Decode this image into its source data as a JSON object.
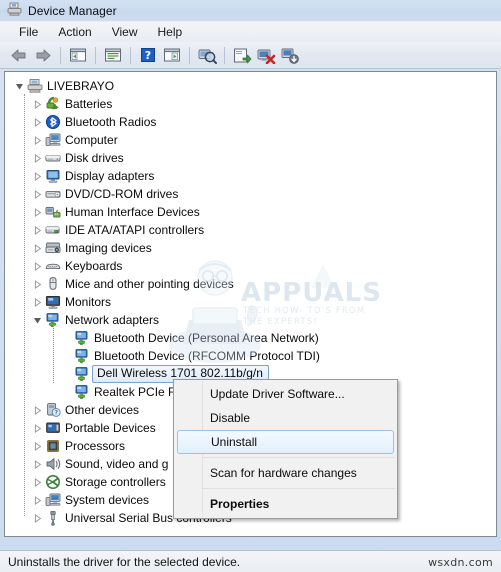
{
  "window": {
    "title": "Device Manager",
    "title_icon": "device-manager-icon"
  },
  "menubar": {
    "items": [
      {
        "label": "File",
        "name": "menu-file"
      },
      {
        "label": "Action",
        "name": "menu-action"
      },
      {
        "label": "View",
        "name": "menu-view"
      },
      {
        "label": "Help",
        "name": "menu-help"
      }
    ]
  },
  "toolbar": {
    "buttons": [
      {
        "name": "back-arrow-icon",
        "title": "Back"
      },
      {
        "name": "forward-arrow-icon",
        "title": "Forward"
      },
      {
        "name": "separator-1",
        "title": ""
      },
      {
        "name": "show-hide-console-tree-icon",
        "title": "Show/Hide Console Tree"
      },
      {
        "name": "separator-2",
        "title": ""
      },
      {
        "name": "properties-icon",
        "title": "Properties"
      },
      {
        "name": "separator-3",
        "title": ""
      },
      {
        "name": "help-icon",
        "title": "Help"
      },
      {
        "name": "separator-4",
        "title": ""
      },
      {
        "name": "show-hide-action-pane-icon",
        "title": "Show/Hide Action Pane"
      },
      {
        "name": "separator-5",
        "title": ""
      },
      {
        "name": "scan-for-hardware-changes-icon",
        "title": "Scan for hardware changes"
      },
      {
        "name": "separator-6",
        "title": ""
      },
      {
        "name": "update-driver-software-icon",
        "title": "Update Driver Software"
      },
      {
        "name": "uninstall-device-icon",
        "title": "Uninstall"
      },
      {
        "name": "add-legacy-hardware-icon",
        "title": "Add legacy hardware"
      }
    ]
  },
  "tree": {
    "root": {
      "label": "LIVEBRAYO",
      "icon": "computer-node-icon",
      "expanded": true
    },
    "nodes": [
      {
        "label": "Batteries",
        "icon": "battery-icon",
        "depth": 1,
        "expanded": false,
        "selected": false
      },
      {
        "label": "Bluetooth Radios",
        "icon": "bluetooth-icon",
        "depth": 1,
        "expanded": false,
        "selected": false
      },
      {
        "label": "Computer",
        "icon": "computer-icon",
        "depth": 1,
        "expanded": false,
        "selected": false
      },
      {
        "label": "Disk drives",
        "icon": "disk-drive-icon",
        "depth": 1,
        "expanded": false,
        "selected": false
      },
      {
        "label": "Display adapters",
        "icon": "display-adapter-icon",
        "depth": 1,
        "expanded": false,
        "selected": false
      },
      {
        "label": "DVD/CD-ROM drives",
        "icon": "dvd-drive-icon",
        "depth": 1,
        "expanded": false,
        "selected": false
      },
      {
        "label": "Human Interface Devices",
        "icon": "hid-icon",
        "depth": 1,
        "expanded": false,
        "selected": false
      },
      {
        "label": "IDE ATA/ATAPI controllers",
        "icon": "ide-controller-icon",
        "depth": 1,
        "expanded": false,
        "selected": false
      },
      {
        "label": "Imaging devices",
        "icon": "imaging-device-icon",
        "depth": 1,
        "expanded": false,
        "selected": false
      },
      {
        "label": "Keyboards",
        "icon": "keyboard-icon",
        "depth": 1,
        "expanded": false,
        "selected": false
      },
      {
        "label": "Mice and other pointing devices",
        "icon": "mouse-icon",
        "depth": 1,
        "expanded": false,
        "selected": false
      },
      {
        "label": "Monitors",
        "icon": "monitor-icon",
        "depth": 1,
        "expanded": false,
        "selected": false
      },
      {
        "label": "Network adapters",
        "icon": "network-adapter-icon",
        "depth": 1,
        "expanded": true,
        "selected": false
      },
      {
        "label": "Bluetooth Device (Personal Area Network)",
        "icon": "network-adapter-icon",
        "depth": 2,
        "expanded": null,
        "selected": false
      },
      {
        "label": "Bluetooth Device (RFCOMM Protocol TDI)",
        "icon": "network-adapter-icon",
        "depth": 2,
        "expanded": null,
        "selected": false
      },
      {
        "label": "Dell Wireless 1701 802.11b/g/n",
        "icon": "network-adapter-icon",
        "depth": 2,
        "expanded": null,
        "selected": true
      },
      {
        "label": "Realtek PCIe FE",
        "icon": "network-adapter-icon",
        "depth": 2,
        "expanded": null,
        "selected": false
      },
      {
        "label": "Other devices",
        "icon": "unknown-device-icon",
        "depth": 1,
        "expanded": false,
        "selected": false
      },
      {
        "label": "Portable Devices",
        "icon": "portable-device-icon",
        "depth": 1,
        "expanded": false,
        "selected": false
      },
      {
        "label": "Processors",
        "icon": "processor-icon",
        "depth": 1,
        "expanded": false,
        "selected": false
      },
      {
        "label": "Sound, video and g",
        "icon": "sound-device-icon",
        "depth": 1,
        "expanded": false,
        "selected": false
      },
      {
        "label": "Storage controllers",
        "icon": "storage-controller-icon",
        "depth": 1,
        "expanded": false,
        "selected": false
      },
      {
        "label": "System devices",
        "icon": "system-device-icon",
        "depth": 1,
        "expanded": false,
        "selected": false
      },
      {
        "label": "Universal Serial Bus controllers",
        "icon": "usb-controller-icon",
        "depth": 1,
        "expanded": false,
        "selected": false
      }
    ]
  },
  "context_menu": {
    "items": [
      {
        "label": "Update Driver Software...",
        "name": "ctx-update-driver-software",
        "highlighted": false,
        "bold": false
      },
      {
        "label": "Disable",
        "name": "ctx-disable",
        "highlighted": false,
        "bold": false
      },
      {
        "label": "Uninstall",
        "name": "ctx-uninstall",
        "highlighted": true,
        "bold": false
      },
      {
        "label": "Scan for hardware changes",
        "name": "ctx-scan-for-hardware-changes",
        "highlighted": false,
        "bold": false
      },
      {
        "label": "Properties",
        "name": "ctx-properties",
        "highlighted": false,
        "bold": true
      }
    ]
  },
  "statusbar": {
    "text": "Uninstalls the driver for the selected device."
  },
  "watermarks": {
    "brand": "APPUALS",
    "tagline_line1": "TECH HOW- TO'S FROM",
    "tagline_line2": "THE EXPERTS!",
    "corner": "wsxdn.com"
  },
  "colors": {
    "titlebar": "#d3e1f3",
    "client_bg": "#ffffff",
    "selection_border": "#7da2ce",
    "menu_bg": "#f1f1f1",
    "highlight_border": "#9cc2e8"
  }
}
